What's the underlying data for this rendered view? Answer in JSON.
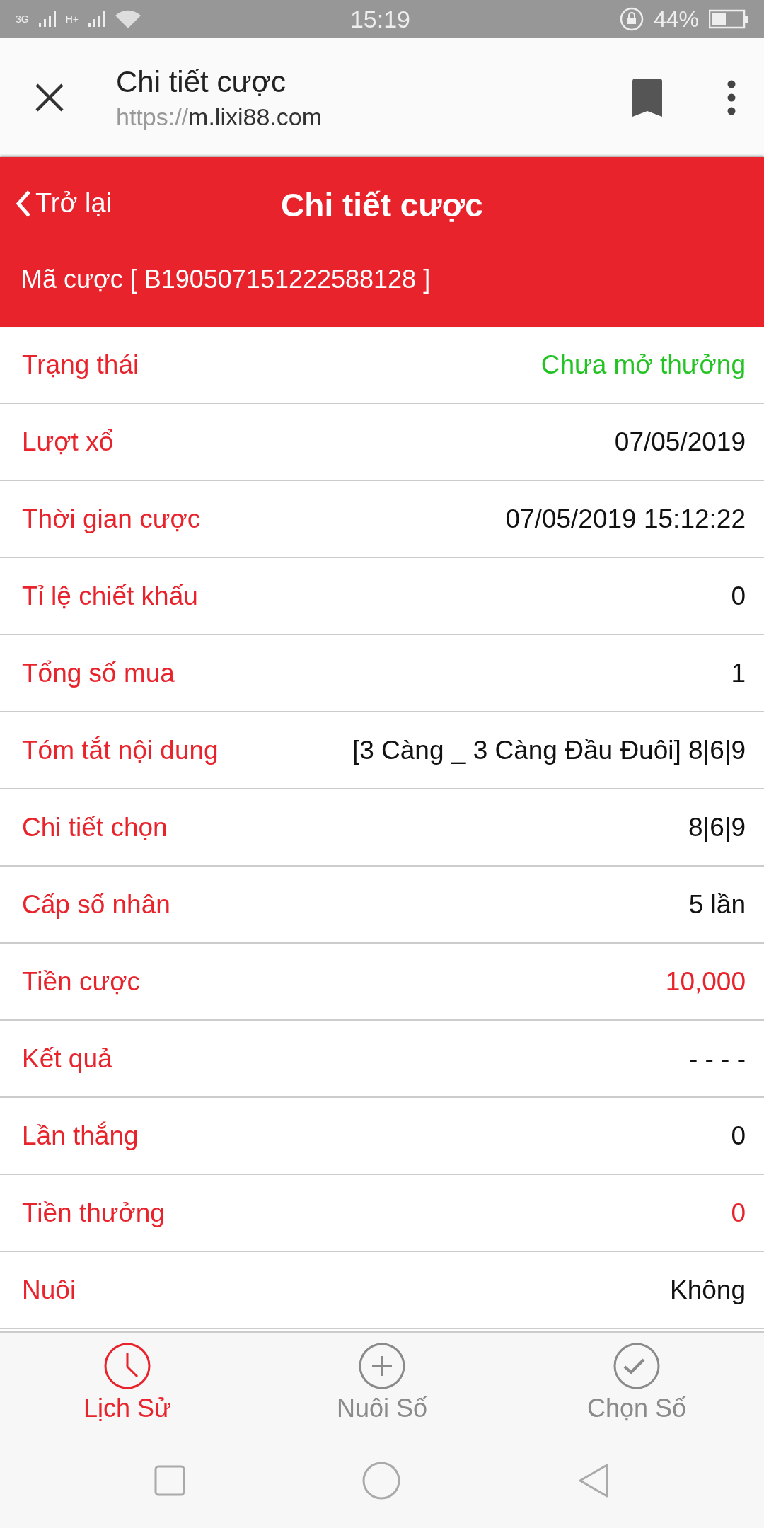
{
  "status_bar": {
    "network_1": "3G",
    "network_2": "H+",
    "time": "15:19",
    "battery": "44%"
  },
  "browser_bar": {
    "title": "Chi tiết cược",
    "url_scheme": "https://",
    "url_host": "m.lixi88.com"
  },
  "header": {
    "back": "Trở lại",
    "title": "Chi tiết cược",
    "code": "Mã cược [ B190507151222588128 ]"
  },
  "rows": [
    {
      "label": "Trạng thái",
      "value": "Chưa mở thưởng",
      "color": "#22c322"
    },
    {
      "label": "Lượt xổ",
      "value": "07/05/2019",
      "color": "#111111"
    },
    {
      "label": "Thời gian cược",
      "value": "07/05/2019 15:12:22",
      "color": "#111111"
    },
    {
      "label": "Tỉ lệ chiết khấu",
      "value": "0",
      "color": "#111111"
    },
    {
      "label": "Tổng số mua",
      "value": "1",
      "color": "#111111"
    },
    {
      "label": "Tóm tắt nội dung",
      "value": "[3 Càng _ 3 Càng Đầu Đuôi] 8|6|9",
      "color": "#111111"
    },
    {
      "label": "Chi tiết chọn",
      "value": "8|6|9",
      "color": "#111111"
    },
    {
      "label": "Cấp số nhân",
      "value": "5 lần",
      "color": "#111111"
    },
    {
      "label": "Tiền cược",
      "value": "10,000",
      "color": "#e8232b"
    },
    {
      "label": "Kết quả",
      "value": "- - - -",
      "color": "#111111"
    },
    {
      "label": "Lần thắng",
      "value": "0",
      "color": "#111111"
    },
    {
      "label": "Tiền thưởng",
      "value": "0",
      "color": "#e8232b"
    },
    {
      "label": "Nuôi",
      "value": "Không",
      "color": "#111111"
    }
  ],
  "tabs": [
    {
      "kind": "clock",
      "label": "Lịch Sử",
      "selected": true
    },
    {
      "kind": "plus",
      "label": "Nuôi Số",
      "selected": false
    },
    {
      "kind": "check",
      "label": "Chọn Số",
      "selected": false
    }
  ]
}
